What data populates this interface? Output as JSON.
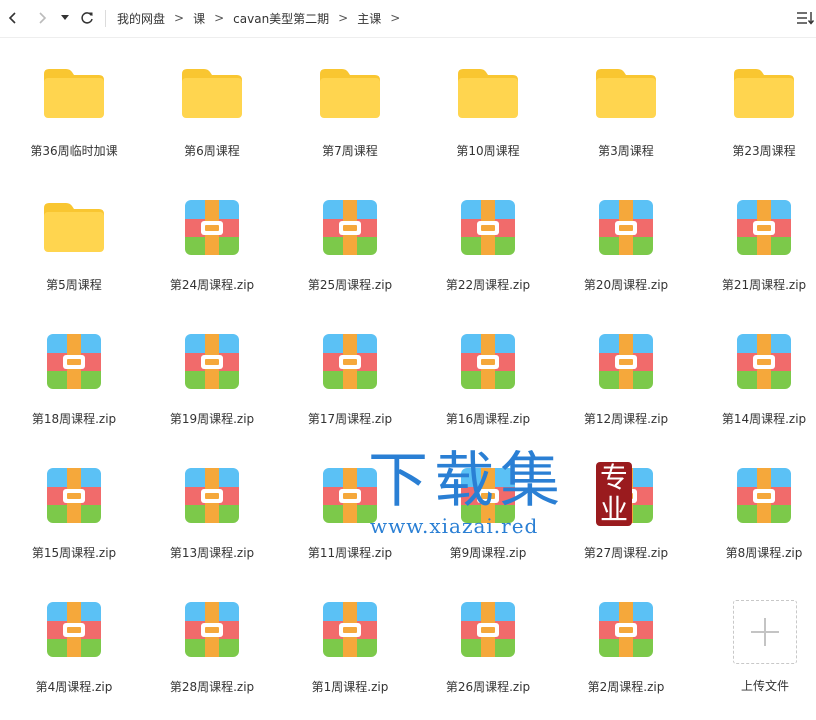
{
  "breadcrumb": [
    "我的网盘",
    "课",
    "cavan美型第二期",
    "主课"
  ],
  "breadcrumb_separator": ">",
  "items": [
    {
      "name": "第36周临时加课",
      "type": "folder"
    },
    {
      "name": "第6周课程",
      "type": "folder"
    },
    {
      "name": "第7周课程",
      "type": "folder"
    },
    {
      "name": "第10周课程",
      "type": "folder"
    },
    {
      "name": "第3周课程",
      "type": "folder"
    },
    {
      "name": "第23周课程",
      "type": "folder"
    },
    {
      "name": "第5周课程",
      "type": "folder"
    },
    {
      "name": "第24周课程.zip",
      "type": "zip"
    },
    {
      "name": "第25周课程.zip",
      "type": "zip"
    },
    {
      "name": "第22周课程.zip",
      "type": "zip"
    },
    {
      "name": "第20周课程.zip",
      "type": "zip"
    },
    {
      "name": "第21周课程.zip",
      "type": "zip"
    },
    {
      "name": "第18周课程.zip",
      "type": "zip"
    },
    {
      "name": "第19周课程.zip",
      "type": "zip"
    },
    {
      "name": "第17周课程.zip",
      "type": "zip"
    },
    {
      "name": "第16周课程.zip",
      "type": "zip"
    },
    {
      "name": "第12周课程.zip",
      "type": "zip"
    },
    {
      "name": "第14周课程.zip",
      "type": "zip"
    },
    {
      "name": "第15周课程.zip",
      "type": "zip"
    },
    {
      "name": "第13周课程.zip",
      "type": "zip"
    },
    {
      "name": "第11周课程.zip",
      "type": "zip"
    },
    {
      "name": "第9周课程.zip",
      "type": "zip"
    },
    {
      "name": "第27周课程.zip",
      "type": "zip"
    },
    {
      "name": "第8周课程.zip",
      "type": "zip"
    },
    {
      "name": "第4周课程.zip",
      "type": "zip"
    },
    {
      "name": "第28周课程.zip",
      "type": "zip"
    },
    {
      "name": "第1周课程.zip",
      "type": "zip"
    },
    {
      "name": "第26周课程.zip",
      "type": "zip"
    },
    {
      "name": "第2周课程.zip",
      "type": "zip"
    }
  ],
  "upload": {
    "label": "上传文件"
  },
  "icons": {
    "back": "chevron-left-icon",
    "forward": "chevron-right-icon",
    "history": "caret-down-icon",
    "refresh": "refresh-icon",
    "sort": "sort-list-icon",
    "folder": "folder-icon",
    "zip": "zip-archive-icon",
    "upload": "plus-icon"
  },
  "colors": {
    "folder": "#ffd54f",
    "folder_tab": "#f9c631",
    "zip_blue": "#5bc1f5",
    "zip_red": "#f16b6b",
    "zip_green": "#7cc94a",
    "zip_strap": "#f5a83b",
    "watermark_blue": "#2a7fd4",
    "watermark_seal": "#9a1b1e"
  },
  "watermark": {
    "main": "下载集",
    "seal": "专业",
    "url": "www.xiazai.red"
  }
}
